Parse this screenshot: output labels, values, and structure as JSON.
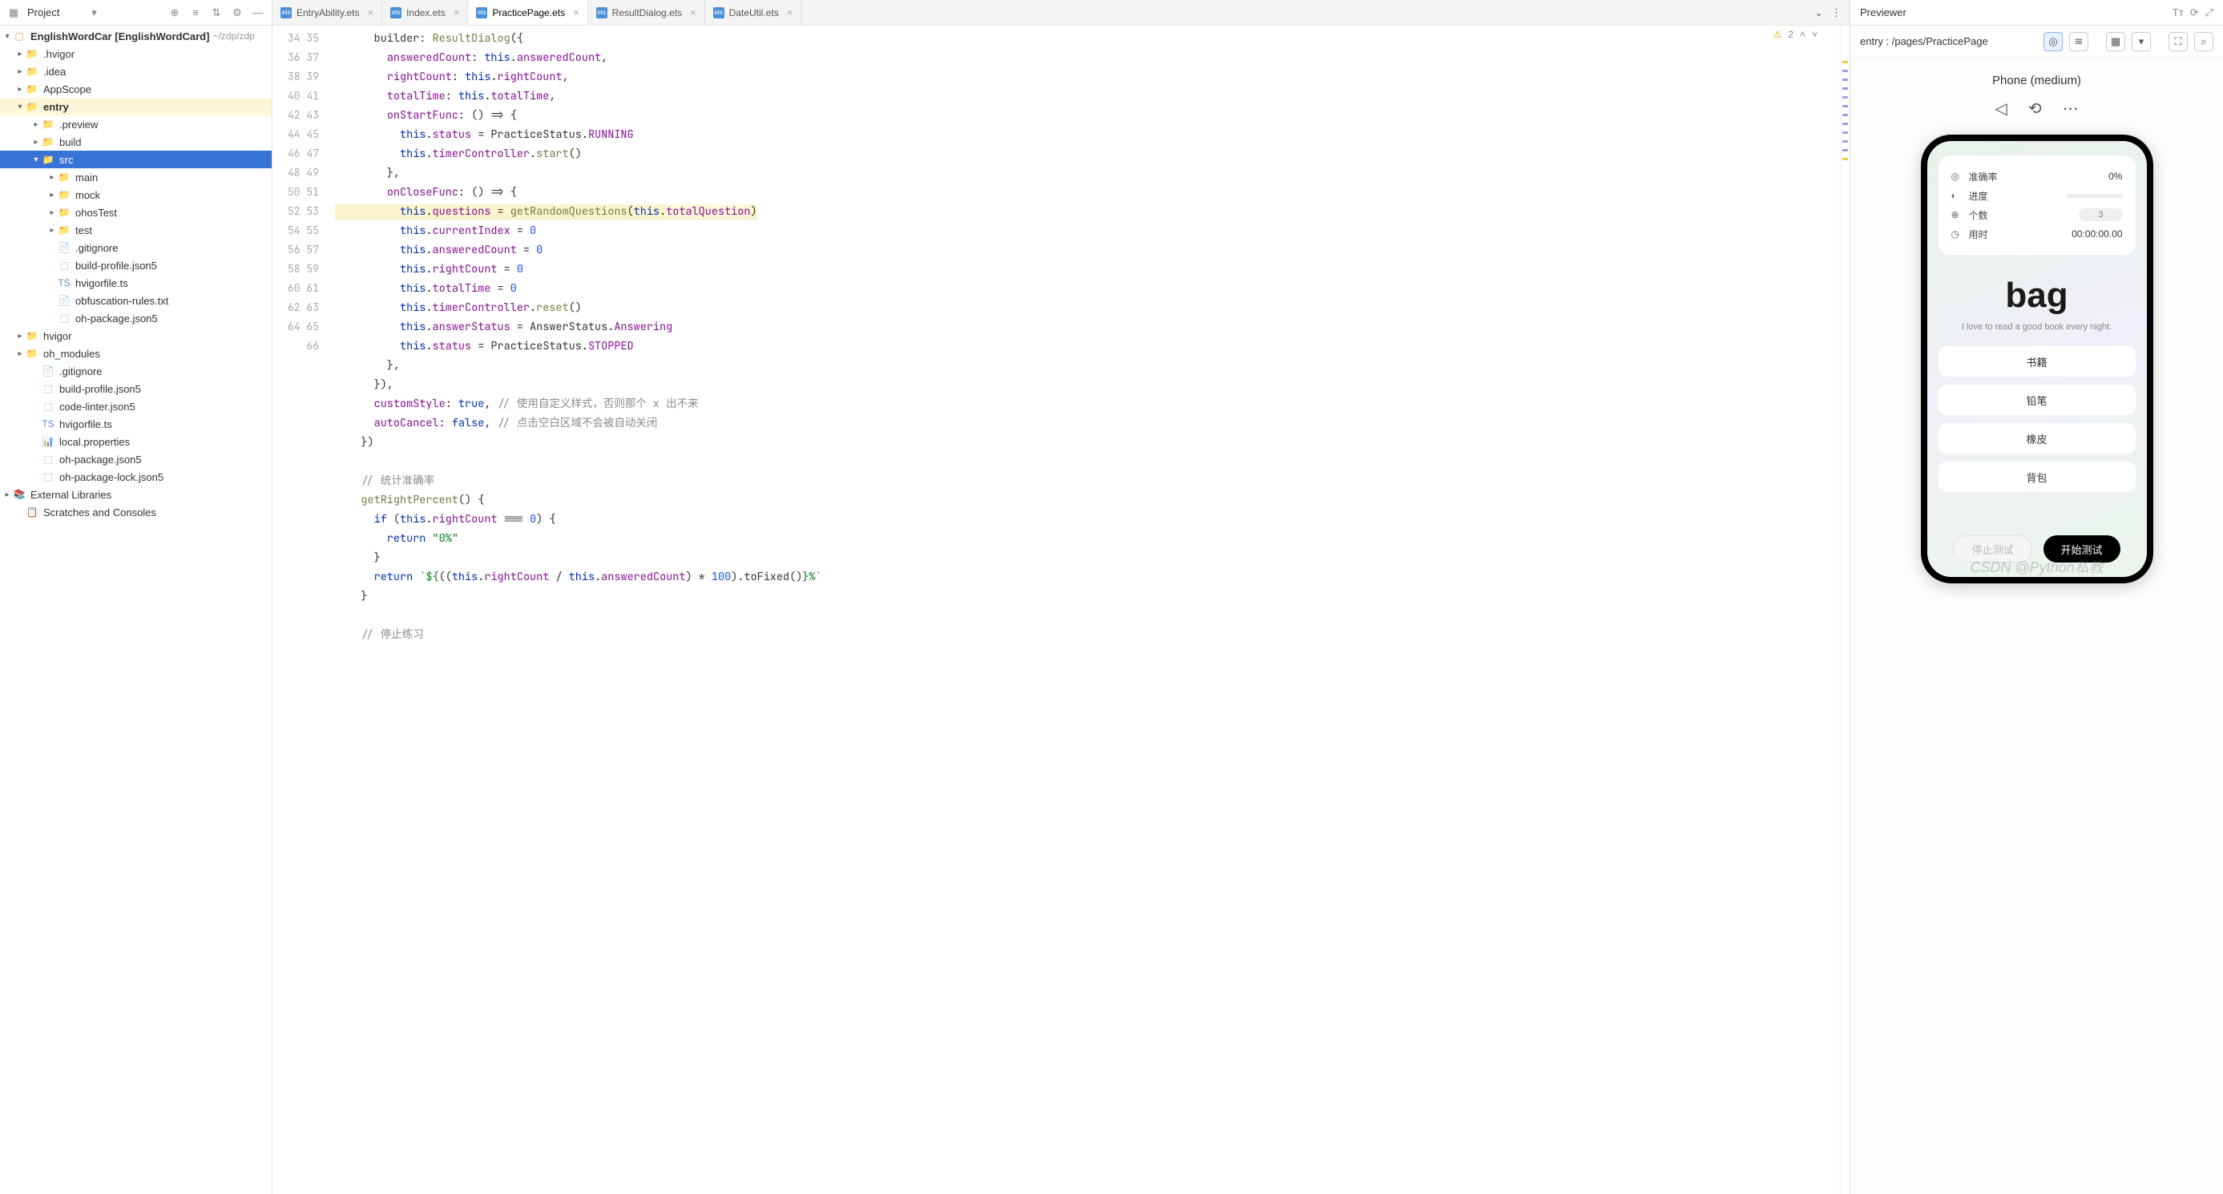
{
  "project": {
    "selector_label": "Project",
    "root_name": "EnglishWordCar",
    "root_bold": "[EnglishWordCard]",
    "root_path": "~/zdp/zdp",
    "tree": {
      "hvigor_d": ".hvigor",
      "idea_d": ".idea",
      "appscope": "AppScope",
      "entry": "entry",
      "preview": ".preview",
      "build": "build",
      "src": "src",
      "main": "main",
      "mock": "mock",
      "ohostest": "ohosTest",
      "test": "test",
      "gitignore_e": ".gitignore",
      "buildprofile_e": "build-profile.json5",
      "hvigorfile_e": "hvigorfile.ts",
      "obfuscation": "obfuscation-rules.txt",
      "ohpackage_e": "oh-package.json5",
      "hvigor_f": "hvigor",
      "ohmodules": "oh_modules",
      "gitignore_r": ".gitignore",
      "buildprofile_r": "build-profile.json5",
      "codelinter": "code-linter.json5",
      "hvigorfile_r": "hvigorfile.ts",
      "localprops": "local.properties",
      "ohpkg_r": "oh-package.json5",
      "ohpkglock": "oh-package-lock.json5",
      "extlibs": "External Libraries",
      "scratches": "Scratches and Consoles"
    }
  },
  "tabs": {
    "t1": "EntryAbility.ets",
    "t2": "Index.ets",
    "t3": "PracticePage.ets",
    "t4": "ResultDialog.ets",
    "t5": "DateUtil.ets"
  },
  "warn_count": "2",
  "gutter_start": 34,
  "gutter_end": 66,
  "code": {
    "l35": {
      "a": "      builder: ",
      "b": "ResultDialog",
      "c": "({"
    },
    "l36": {
      "a": "        ",
      "b": "answeredCount",
      "c": ": ",
      "d": "this",
      "e": ".",
      "f": "answeredCount",
      "g": ","
    },
    "l37": {
      "a": "        ",
      "b": "rightCount",
      "c": ": ",
      "d": "this",
      "e": ".",
      "f": "rightCount",
      "g": ","
    },
    "l38": {
      "a": "        ",
      "b": "totalTime",
      "c": ": ",
      "d": "this",
      "e": ".",
      "f": "totalTime",
      "g": ","
    },
    "l39": {
      "a": "        ",
      "b": "onStartFunc",
      "c": ": () => {"
    },
    "l40": {
      "a": "          ",
      "b": "this",
      "c": ".",
      "d": "status",
      "e": " = PracticeStatus.",
      "f": "RUNNING"
    },
    "l41": {
      "a": "          ",
      "b": "this",
      "c": ".",
      "d": "timerController",
      "e": ".",
      "f": "start",
      "g": "()"
    },
    "l42": {
      "a": "        },"
    },
    "l43": {
      "a": "        ",
      "b": "onCloseFunc",
      "c": ": () => {"
    },
    "l44": {
      "a": "          ",
      "b": "this",
      "c": ".",
      "d": "questions",
      "e": " = ",
      "f": "getRandomQuestions",
      "g": "(",
      "h": "this",
      "i": ".",
      "j": "totalQuestion",
      "k": ")"
    },
    "l45": {
      "a": "          ",
      "b": "this",
      "c": ".",
      "d": "currentIndex",
      "e": " = ",
      "f": "0"
    },
    "l46": {
      "a": "          ",
      "b": "this",
      "c": ".",
      "d": "answeredCount",
      "e": " = ",
      "f": "0"
    },
    "l47": {
      "a": "          ",
      "b": "this",
      "c": ".",
      "d": "rightCount",
      "e": " = ",
      "f": "0"
    },
    "l48": {
      "a": "          ",
      "b": "this",
      "c": ".",
      "d": "totalTime",
      "e": " = ",
      "f": "0"
    },
    "l49": {
      "a": "          ",
      "b": "this",
      "c": ".",
      "d": "timerController",
      "e": ".",
      "f": "reset",
      "g": "()"
    },
    "l50": {
      "a": "          ",
      "b": "this",
      "c": ".",
      "d": "answerStatus",
      "e": " = AnswerStatus.",
      "f": "Answering"
    },
    "l51": {
      "a": "          ",
      "b": "this",
      "c": ".",
      "d": "status",
      "e": " = PracticeStatus.",
      "f": "STOPPED"
    },
    "l52": {
      "a": "        },"
    },
    "l53": {
      "a": "      }),"
    },
    "l54": {
      "a": "      ",
      "b": "customStyle",
      "c": ": ",
      "d": "true",
      "e": ", ",
      "f": "// 使用自定义样式，否则那个 x 出不来"
    },
    "l55": {
      "a": "      ",
      "b": "autoCancel",
      "c": ": ",
      "d": "false",
      "e": ", ",
      "f": "// 点击空白区域不会被自动关闭"
    },
    "l56": {
      "a": "    })"
    },
    "l57": {
      "a": ""
    },
    "l58": {
      "a": "    ",
      "b": "// 统计准确率"
    },
    "l59": {
      "a": "    ",
      "b": "getRightPercent",
      "c": "() {"
    },
    "l60": {
      "a": "      ",
      "b": "if ",
      "c": "(",
      "d": "this",
      "e": ".",
      "f": "rightCount",
      "g": " === ",
      "h": "0",
      "i": ") {"
    },
    "l61": {
      "a": "        ",
      "b": "return ",
      "c": "\"0%\""
    },
    "l62": {
      "a": "      }"
    },
    "l63": {
      "a": "      ",
      "b": "return ",
      "c": "`${",
      "d": "((",
      "e": "this",
      "f": ".",
      "g": "rightCount",
      "h": " / ",
      "i": "this",
      "j": ".",
      "k": "answeredCount",
      "l": ") * ",
      "m": "100",
      "n": ").toFixed()",
      "o": "}%`"
    },
    "l64": {
      "a": "    }"
    },
    "l65": {
      "a": ""
    },
    "l66": {
      "a": "    ",
      "b": "// 停止练习"
    }
  },
  "previewer": {
    "title": "Previewer",
    "entry": "entry : /pages/PracticePage",
    "device": "Phone (medium)",
    "stats": {
      "accuracy_lbl": "准确率",
      "accuracy_val": "0%",
      "progress_lbl": "进度",
      "count_lbl": "个数",
      "count_val": "3",
      "time_lbl": "用时",
      "time_val": "00:00:00.00"
    },
    "word": "bag",
    "sentence": "I love to read a good book every night.",
    "options": {
      "o1": "书籍",
      "o2": "铅笔",
      "o3": "橡皮",
      "o4": "背包"
    },
    "btn_stop": "停止测试",
    "btn_start": "开始测试"
  },
  "watermark": "CSDN @Python私教"
}
